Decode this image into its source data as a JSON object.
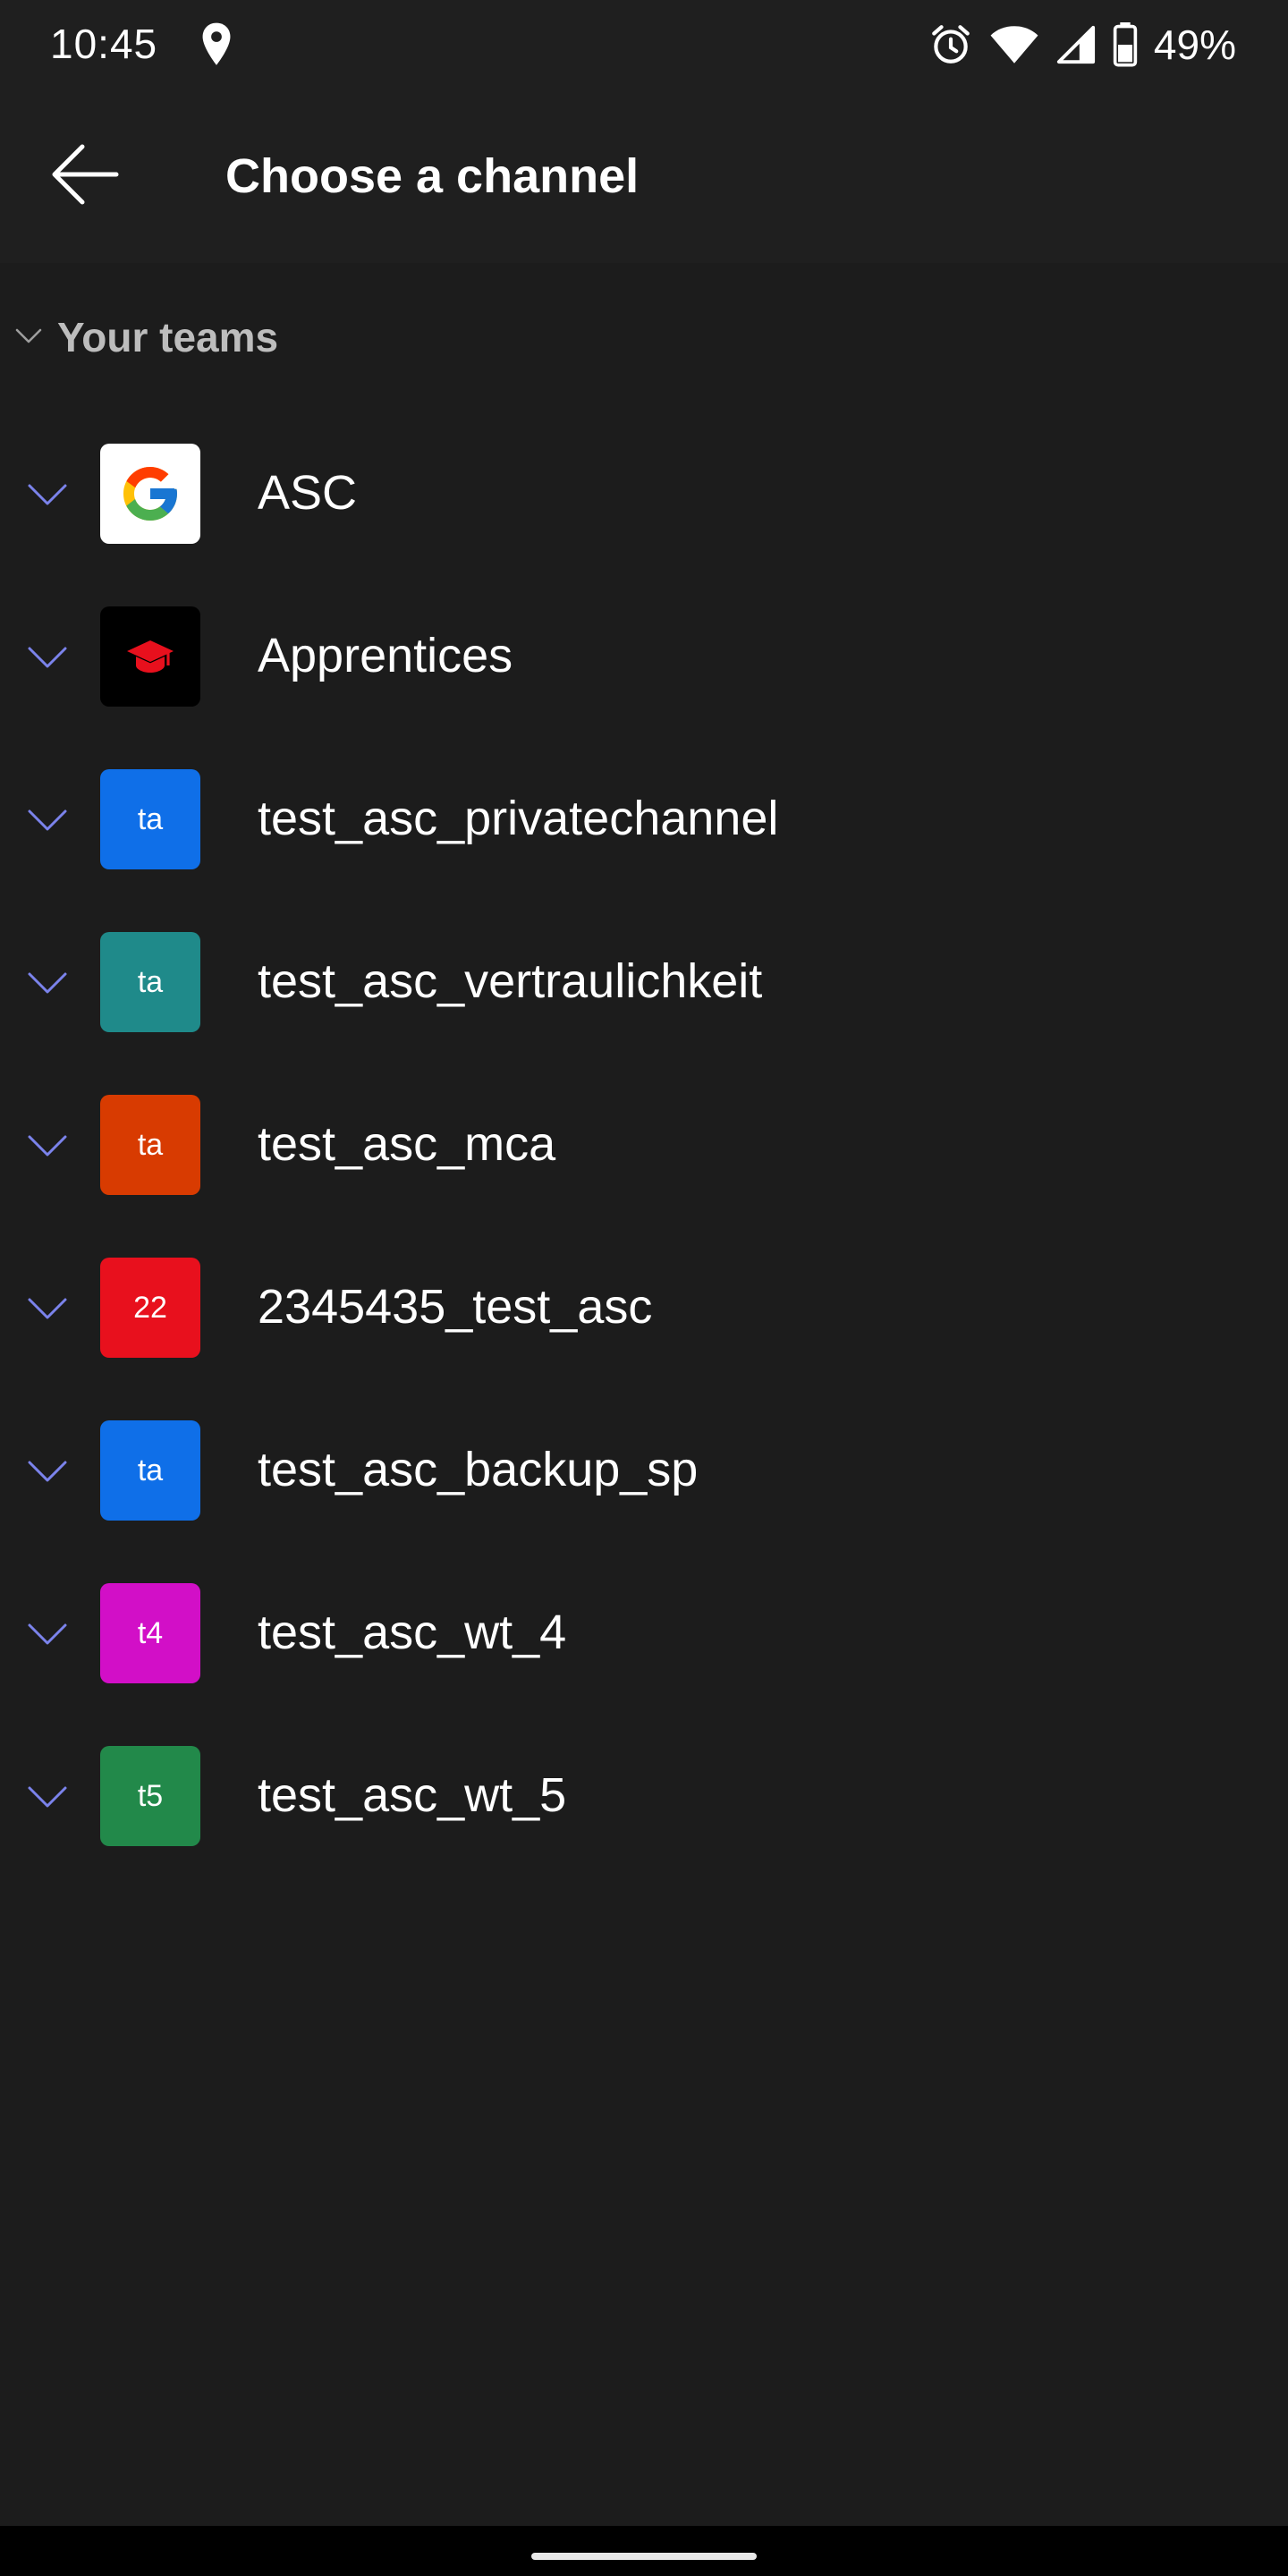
{
  "status_bar": {
    "time": "10:45",
    "battery": "49%",
    "icons": [
      "location-icon",
      "alarm-icon",
      "wifi-icon",
      "signal-icon",
      "battery-icon"
    ]
  },
  "header": {
    "title": "Choose a channel",
    "back_icon": "arrow-left-icon"
  },
  "section": {
    "label": "Your teams",
    "icon": "chevron-down-icon"
  },
  "teams": [
    {
      "name": "ASC",
      "avatar_text": "",
      "avatar_color": "#ffffff",
      "avatar_icon": "google-logo-icon"
    },
    {
      "name": "Apprentices",
      "avatar_text": "",
      "avatar_color": "#000000",
      "avatar_icon": "graduation-cap-icon"
    },
    {
      "name": "test_asc_privatechannel",
      "avatar_text": "ta",
      "avatar_color": "#0f6fe8"
    },
    {
      "name": "test_asc_vertraulichkeit",
      "avatar_text": "ta",
      "avatar_color": "#1f8a8a"
    },
    {
      "name": "test_asc_mca",
      "avatar_text": "ta",
      "avatar_color": "#d83b01"
    },
    {
      "name": "2345435_test_asc",
      "avatar_text": "22",
      "avatar_color": "#e8101d"
    },
    {
      "name": "test_asc_backup_sp",
      "avatar_text": "ta",
      "avatar_color": "#0f6fe8"
    },
    {
      "name": "test_asc_wt_4",
      "avatar_text": "t4",
      "avatar_color": "#d20fc7"
    },
    {
      "name": "test_asc_wt_5",
      "avatar_text": "t5",
      "avatar_color": "#22894a"
    }
  ],
  "colors": {
    "accent_chevron": "#7b83eb",
    "background": "#1c1c1c",
    "header_background": "#1f1f1f"
  }
}
